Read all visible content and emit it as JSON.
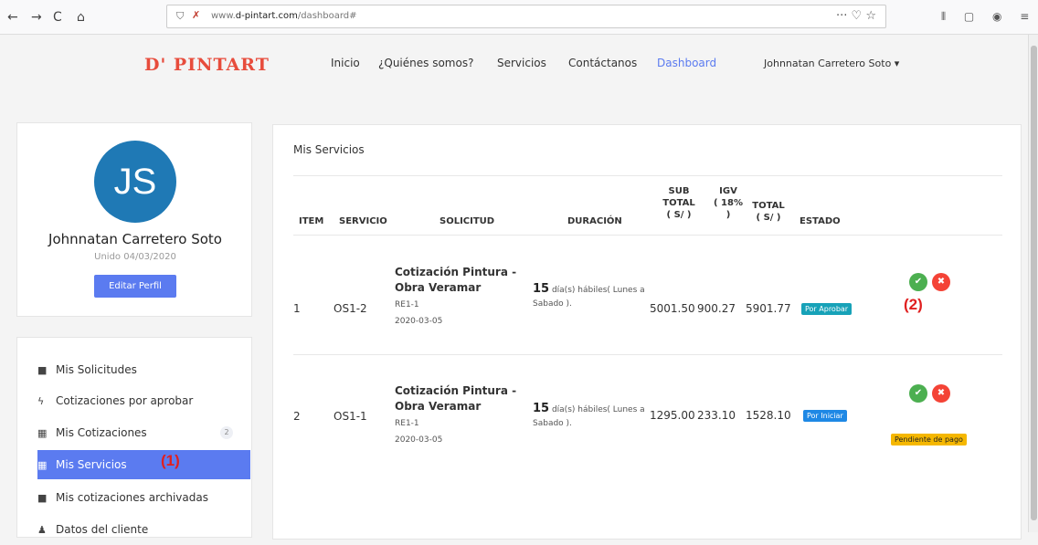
{
  "browser": {
    "back": "←",
    "forward": "→",
    "reload": "C",
    "home": "⌂",
    "url_prefix": "www.",
    "url_domain": "d-pintart.com",
    "url_path": "/dashboard#",
    "url_right_icons": "··· ♡ ☆",
    "toolbar_icons": "⫴ ▢ ◉ ≡"
  },
  "header": {
    "logo": "D' PINTART",
    "nav": [
      "Inicio",
      "¿Quiénes somos?",
      "Servicios",
      "Contáctanos",
      "Dashboard"
    ],
    "user": "Johnnatan Carretero Soto ▾",
    "accent_color": "#5b7bf0"
  },
  "profile": {
    "initials": "JS",
    "name": "Johnnatan Carretero Soto",
    "joined": "Unido 04/03/2020",
    "edit_label": "Editar Perfil"
  },
  "sidebar": {
    "items": [
      {
        "icon": "■",
        "label": "Mis Solicitudes"
      },
      {
        "icon": "ϟ",
        "label": "Cotizaciones por aprobar"
      },
      {
        "icon": "▦",
        "label": "Mis Cotizaciones",
        "count": "2"
      },
      {
        "icon": "▦",
        "label": "Mis Servicios"
      },
      {
        "icon": "■",
        "label": "Mis cotizaciones archivadas"
      },
      {
        "icon": "♟",
        "label": "Datos del cliente"
      }
    ]
  },
  "annotations": {
    "one": "(1)",
    "two": "(2)"
  },
  "services": {
    "title": "Mis Servicios",
    "headers": {
      "item": "ITEM",
      "servicio": "SERVICIO",
      "solicitud": "SOLICITUD",
      "duracion": "DURACIÓN",
      "subtotal": "SUB\nTOTAL\n( S/ )",
      "igv": "IGV\n( 18%\n)",
      "total": "TOTAL\n( S/ )",
      "estado": "ESTADO"
    },
    "rows": [
      {
        "item": "1",
        "servicio": "OS1-2",
        "sol_title": "Cotización Pintura - Obra Veramar",
        "sol_code": "RE1-1",
        "sol_date": "2020-03-05",
        "dur_num": "15",
        "dur_text": " día(s) hábiles( Lunes a Sabado ).",
        "subtotal": "5001.50",
        "igv": "900.27",
        "total": "5901.77",
        "estado": "Por Aprobar",
        "estado_color": "#17a2b8",
        "extra": ""
      },
      {
        "item": "2",
        "servicio": "OS1-1",
        "sol_title": "Cotización Pintura - Obra Veramar",
        "sol_code": "RE1-1",
        "sol_date": "2020-03-05",
        "dur_num": "15",
        "dur_text": " día(s) hábiles( Lunes a Sabado ).",
        "subtotal": "1295.00",
        "igv": "233.10",
        "total": "1528.10",
        "estado": "Por Iniciar",
        "estado_color": "#1e88e5",
        "extra": "Pendiente de pago"
      }
    ],
    "approve_icon": "✔",
    "reject_icon": "✖",
    "approve_color": "#4caf50",
    "reject_color": "#f44336"
  }
}
